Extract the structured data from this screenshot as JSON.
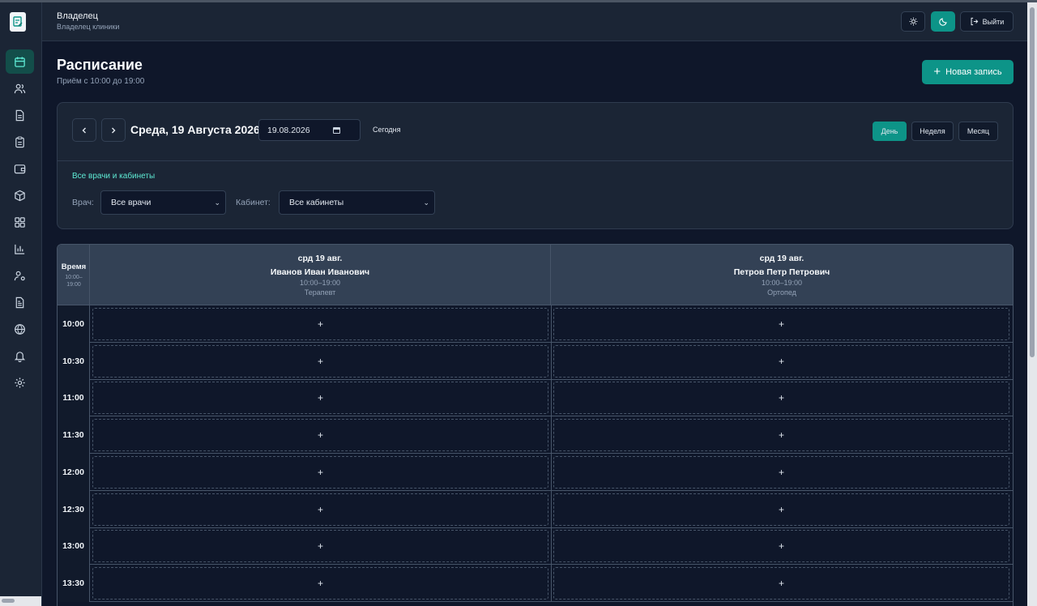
{
  "header": {
    "role_title": "Владелец",
    "role_subtitle": "Владелец клиники",
    "logout_label": "Выйти",
    "theme_light_icon": "sun-icon",
    "theme_dark_icon": "moon-icon"
  },
  "sidebar": {
    "items": [
      {
        "name": "calendar",
        "icon": "calendar-icon",
        "active": true
      },
      {
        "name": "patients",
        "icon": "users-icon"
      },
      {
        "name": "documents",
        "icon": "document-icon"
      },
      {
        "name": "clipboard",
        "icon": "clipboard-icon"
      },
      {
        "name": "wallet",
        "icon": "wallet-icon"
      },
      {
        "name": "inventory",
        "icon": "box-icon"
      },
      {
        "name": "dashboard",
        "icon": "grid-icon"
      },
      {
        "name": "analytics",
        "icon": "bar-chart-icon"
      },
      {
        "name": "staff",
        "icon": "user-settings-icon"
      },
      {
        "name": "reports",
        "icon": "file-text-icon"
      },
      {
        "name": "website",
        "icon": "globe-icon"
      },
      {
        "name": "notifications",
        "icon": "bell-icon"
      },
      {
        "name": "settings",
        "icon": "gear-icon"
      }
    ]
  },
  "page": {
    "title": "Расписание",
    "subtitle": "Приём с 10:00 до 19:00",
    "new_button": "Новая запись"
  },
  "toolbar": {
    "date_title": "Среда, 19 Августа 2026",
    "date_value": "19.08.2026",
    "today_label": "Сегодня",
    "views": [
      "День",
      "Неделя",
      "Месяц"
    ],
    "active_view": "День"
  },
  "filters": {
    "link": "Все врачи и кабинеты",
    "doctor_label": "Врач:",
    "doctor_value": "Все врачи",
    "room_label": "Кабинет:",
    "room_value": "Все кабинеты"
  },
  "schedule": {
    "time_header": "Время",
    "time_range_1": "10:00–",
    "time_range_2": "19:00",
    "doctors": [
      {
        "date": "срд 19 авг.",
        "name": "Иванов Иван Иванович",
        "hours": "10:00–19:00",
        "specialty": "Терапевт"
      },
      {
        "date": "срд 19 авг.",
        "name": "Петров Петр Петрович",
        "hours": "10:00–19:00",
        "specialty": "Ортопед"
      }
    ],
    "slots": [
      "10:00",
      "10:30",
      "11:00",
      "11:30",
      "12:00",
      "12:30",
      "13:00",
      "13:30"
    ],
    "add_symbol": "+"
  },
  "colors": {
    "accent": "#0d9488",
    "background": "#0f172a",
    "panel": "#1b2535"
  }
}
